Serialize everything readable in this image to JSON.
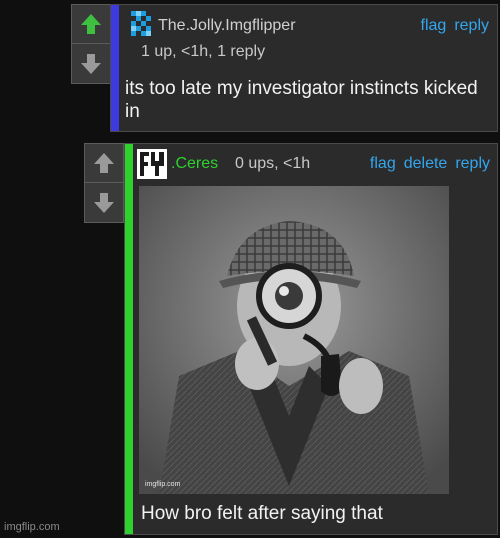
{
  "comment1": {
    "username": "The.Jolly.Imgflipper",
    "meta": "1 up, <1h, 1 reply",
    "actions": [
      "flag",
      "reply"
    ],
    "text": "its too late my investigator instincts kicked in",
    "bar_color": "#3d3ae0",
    "username_color": "#d0d0d0"
  },
  "comment2": {
    "username": ".Ceres",
    "meta": "0 ups, <1h",
    "actions": [
      "flag",
      "delete",
      "reply"
    ],
    "caption": "How bro felt after saying that",
    "image_watermark": "imgflip.com",
    "bar_color": "#2fd12f",
    "username_color": "#2fd12f"
  },
  "footer": {
    "watermark": "imgflip.com"
  },
  "icons": {
    "upvote_active": "arrow-up-green-icon",
    "upvote": "arrow-up-icon",
    "downvote": "arrow-down-icon",
    "avatar1": "pixel-avatar-icon",
    "avatar2": "letter-avatar-icon"
  },
  "colors": {
    "accent_link": "#33a6ee",
    "upvote_green": "#3fbf3f",
    "panel": "#2b2b2b",
    "page_bg": "#0f0f0f"
  }
}
